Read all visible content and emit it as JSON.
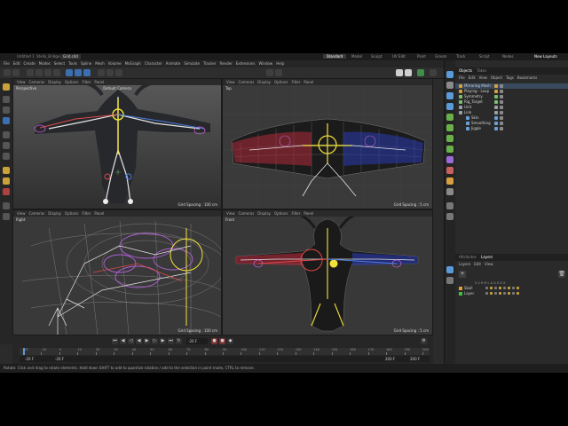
{
  "tabs": [
    "Untitled 1",
    "Stella_Bridge.c4d",
    "Grid.c4d"
  ],
  "active_tab_index": 2,
  "layouts": [
    "Standard",
    "Model",
    "Sculpt",
    "UV Edit",
    "Paint",
    "Groom",
    "Track",
    "Script",
    "Nodes"
  ],
  "layouts_active": "Standard",
  "new_layouts": "New Layouts",
  "menu": [
    "File",
    "Edit",
    "Create",
    "Modes",
    "Select",
    "Tools",
    "Spline",
    "Mesh",
    "Volume",
    "MoGraph",
    "Character",
    "Animate",
    "Simulate",
    "Tracker",
    "Render",
    "Extensions",
    "Window",
    "Help"
  ],
  "viewport_menu": [
    "View",
    "Cameras",
    "Display",
    "Options",
    "Filter",
    "Panel"
  ],
  "viewports": {
    "perspective": {
      "label": "Perspective",
      "camera": "Default Camera",
      "grid": "Grid Spacing : 100 cm"
    },
    "top": {
      "label": "Top",
      "grid": "Grid Spacing : 5 cm"
    },
    "right": {
      "label": "Right",
      "grid": "Grid Spacing : 100 cm"
    },
    "front": {
      "label": "Front",
      "grid": "Grid Spacing : 5 cm"
    }
  },
  "timeline": {
    "current_frame": "-20 F",
    "start": "-20 F",
    "start2": "-20 F",
    "end": "200 F",
    "end2": "200 F",
    "ticks": [
      "-20",
      "-10",
      "0",
      "10",
      "20",
      "30",
      "40",
      "50",
      "60",
      "70",
      "80",
      "90",
      "100",
      "110",
      "120",
      "130",
      "140",
      "150",
      "160",
      "170",
      "180",
      "190",
      "200"
    ]
  },
  "status": "Rotate: Click and drag to rotate elements. Hold down SHIFT to add to quantize rotation / add to the selection in point mode, CTRL to remove.",
  "objects_panel": {
    "tabs": [
      "Objects",
      "Takes"
    ],
    "menu": [
      "File",
      "Edit",
      "View",
      "Object",
      "Tags",
      "Bookmarks"
    ],
    "rows": [
      {
        "name": "Mirroring Mesh",
        "indent": 0,
        "color": "#d8a040"
      },
      {
        "name": "Playing - Loop",
        "indent": 0,
        "color": "#d8a040"
      },
      {
        "name": "Symmetry",
        "indent": 0,
        "color": "#7ac070"
      },
      {
        "name": "Rig_Target",
        "indent": 0,
        "color": "#7ac070"
      },
      {
        "name": "Unit",
        "indent": 0,
        "color": "#9aa0aa"
      },
      {
        "name": "Link",
        "indent": 0,
        "color": "#9aa0aa"
      },
      {
        "name": "Skin",
        "indent": 1,
        "color": "#6aa0d8"
      },
      {
        "name": "Smoothing",
        "indent": 1,
        "color": "#6aa0d8"
      },
      {
        "name": "Jiggle",
        "indent": 1,
        "color": "#6aa0d8"
      }
    ]
  },
  "layers_panel": {
    "tabs": [
      "Attributes",
      "Layers"
    ],
    "menu": [
      "Layers",
      "Edit",
      "View"
    ],
    "columns": "S V R M L A G D E X",
    "rows": [
      {
        "name": "Skull",
        "color": "#e0a030"
      },
      {
        "name": "Layer",
        "color": "#40c040"
      }
    ]
  }
}
